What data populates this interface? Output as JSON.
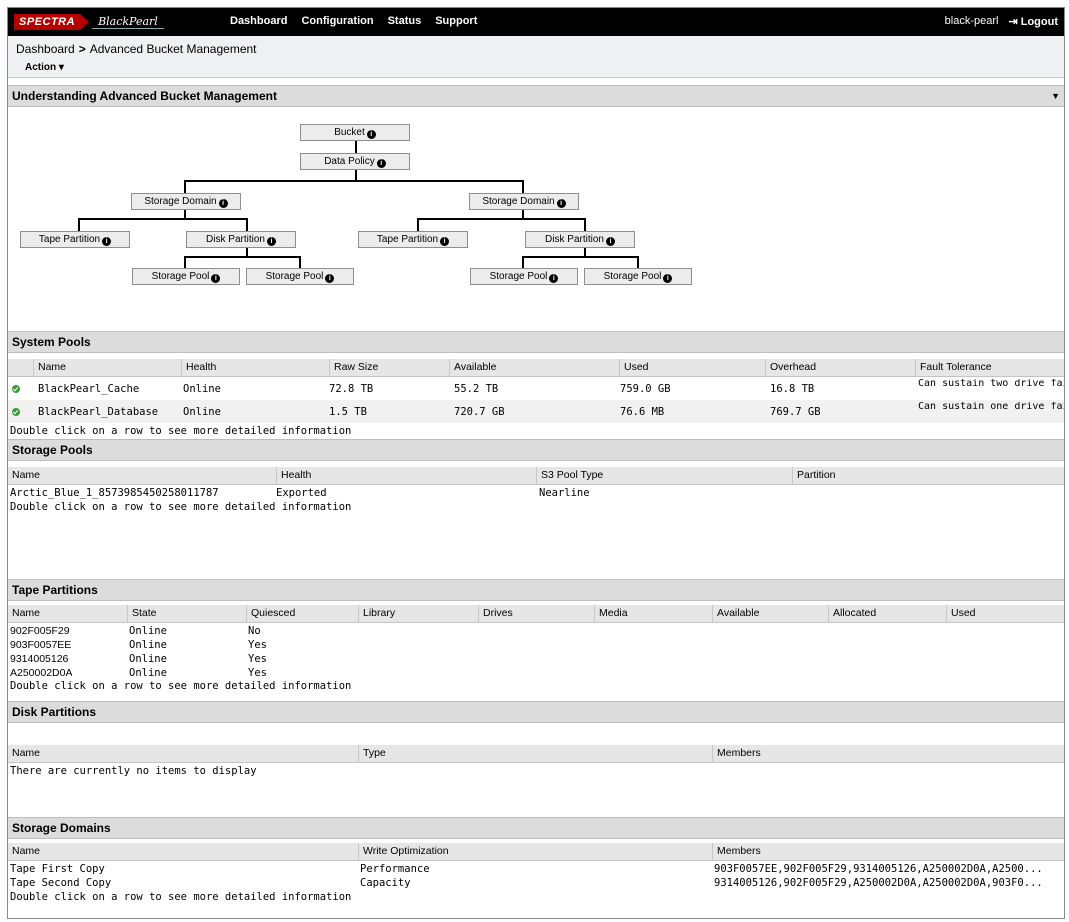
{
  "nav": {
    "logo_spectra": "SPECTRA",
    "logo_blackpearl": "BlackPearl",
    "links": [
      "Dashboard",
      "Configuration",
      "Status",
      "Support"
    ],
    "user": "black-pearl",
    "logout": "Logout"
  },
  "breadcrumb": {
    "root": "Dashboard",
    "current": "Advanced Bucket Management"
  },
  "action_menu": "Action",
  "understanding": {
    "title": "Understanding Advanced Bucket Management",
    "nodes": {
      "bucket": "Bucket",
      "data_policy": "Data Policy",
      "storage_domain": "Storage Domain",
      "tape_partition": "Tape Partition",
      "disk_partition": "Disk Partition",
      "storage_pool": "Storage Pool"
    }
  },
  "system_pools": {
    "title": "System Pools",
    "columns": [
      "Name",
      "Health",
      "Raw Size",
      "Available",
      "Used",
      "Overhead",
      "Fault Tolerance"
    ],
    "rows": [
      {
        "name": "BlackPearl_Cache",
        "health": "Online",
        "raw": "72.8 TB",
        "available": "55.2 TB",
        "used": "759.0 GB",
        "overhead": "16.8 TB",
        "fault": "Can sustain two drive failures per array."
      },
      {
        "name": "BlackPearl_Database",
        "health": "Online",
        "raw": "1.5 TB",
        "available": "720.7 GB",
        "used": "76.6 MB",
        "overhead": "769.7 GB",
        "fault": "Can sustain one drive failure per mirror."
      }
    ],
    "hint": "Double click on a row to see more detailed information"
  },
  "storage_pools": {
    "title": "Storage Pools",
    "columns": [
      "Name",
      "Health",
      "S3 Pool Type",
      "Partition"
    ],
    "rows": [
      {
        "name": "Arctic_Blue_1_8573985450258011787",
        "health": "Exported",
        "type": "Nearline",
        "partition": ""
      }
    ],
    "hint": "Double click on a row to see more detailed information"
  },
  "tape_partitions": {
    "title": "Tape Partitions",
    "columns": [
      "Name",
      "State",
      "Quiesced",
      "Library",
      "Drives",
      "Media",
      "Available",
      "Allocated",
      "Used"
    ],
    "rows": [
      {
        "name": "902F005F29",
        "state": "Online",
        "quiesced": "No"
      },
      {
        "name": "903F0057EE",
        "state": "Online",
        "quiesced": "Yes"
      },
      {
        "name": "9314005126",
        "state": "Online",
        "quiesced": "Yes"
      },
      {
        "name": "A250002D0A",
        "state": "Online",
        "quiesced": "Yes"
      }
    ],
    "hint": "Double click on a row to see more detailed information"
  },
  "disk_partitions": {
    "title": "Disk Partitions",
    "columns": [
      "Name",
      "Type",
      "Members"
    ],
    "empty": "There are currently no items to display"
  },
  "storage_domains": {
    "title": "Storage Domains",
    "columns": [
      "Name",
      "Write Optimization",
      "Members"
    ],
    "rows": [
      {
        "name": "Tape First Copy",
        "write": "Performance",
        "members": "903F0057EE,902F005F29,9314005126,A250002D0A,A2500..."
      },
      {
        "name": "Tape Second Copy",
        "write": "Capacity",
        "members": "9314005126,902F005F29,A250002D0A,A250002D0A,903F0..."
      }
    ],
    "hint": "Double click on a row to see more detailed information"
  },
  "colors": {
    "nav_bg": "#000000",
    "logo_red": "#b50000",
    "ok_green": "#3a9a3a",
    "section_bg": "#dcdcdc"
  },
  "icons": [
    "info-icon",
    "ok-status-icon",
    "chevron-down-icon",
    "chevron-right-icon",
    "logout-icon"
  ]
}
